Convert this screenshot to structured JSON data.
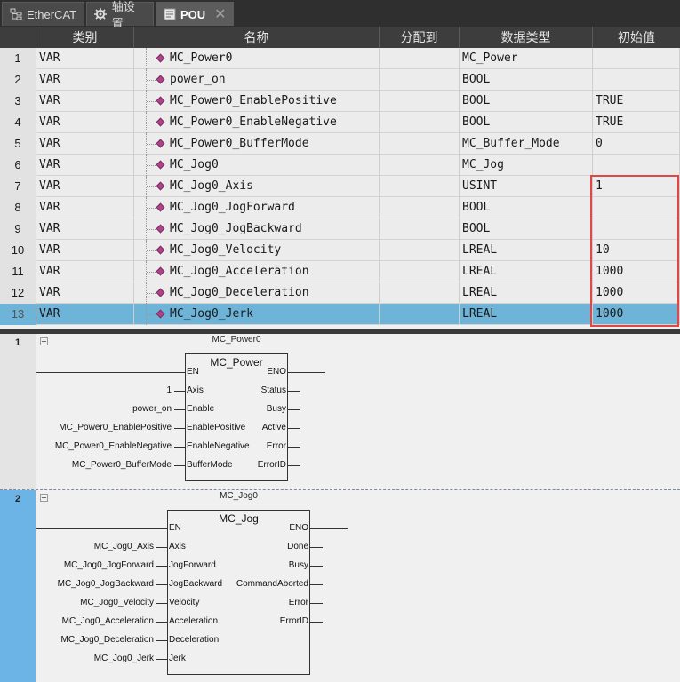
{
  "tabs": [
    {
      "label": "EtherCAT",
      "icon": "network-tree-icon"
    },
    {
      "label": "轴设置",
      "icon": "gear-icon"
    },
    {
      "label": "POU",
      "icon": "pou-icon"
    }
  ],
  "table": {
    "headers": [
      "类别",
      "名称",
      "分配到",
      "数据类型",
      "初始值"
    ],
    "rows": [
      {
        "num": "1",
        "cat": "VAR",
        "name": "MC_Power0",
        "alloc": "",
        "type": "MC_Power",
        "init": ""
      },
      {
        "num": "2",
        "cat": "VAR",
        "name": "power_on",
        "alloc": "",
        "type": "BOOL",
        "init": ""
      },
      {
        "num": "3",
        "cat": "VAR",
        "name": "MC_Power0_EnablePositive",
        "alloc": "",
        "type": "BOOL",
        "init": "TRUE"
      },
      {
        "num": "4",
        "cat": "VAR",
        "name": "MC_Power0_EnableNegative",
        "alloc": "",
        "type": "BOOL",
        "init": "TRUE"
      },
      {
        "num": "5",
        "cat": "VAR",
        "name": "MC_Power0_BufferMode",
        "alloc": "",
        "type": "MC_Buffer_Mode",
        "init": "0"
      },
      {
        "num": "6",
        "cat": "VAR",
        "name": "MC_Jog0",
        "alloc": "",
        "type": "MC_Jog",
        "init": ""
      },
      {
        "num": "7",
        "cat": "VAR",
        "name": "MC_Jog0_Axis",
        "alloc": "",
        "type": "USINT",
        "init": "1"
      },
      {
        "num": "8",
        "cat": "VAR",
        "name": "MC_Jog0_JogForward",
        "alloc": "",
        "type": "BOOL",
        "init": ""
      },
      {
        "num": "9",
        "cat": "VAR",
        "name": "MC_Jog0_JogBackward",
        "alloc": "",
        "type": "BOOL",
        "init": ""
      },
      {
        "num": "10",
        "cat": "VAR",
        "name": "MC_Jog0_Velocity",
        "alloc": "",
        "type": "LREAL",
        "init": "10"
      },
      {
        "num": "11",
        "cat": "VAR",
        "name": "MC_Jog0_Acceleration",
        "alloc": "",
        "type": "LREAL",
        "init": "1000"
      },
      {
        "num": "12",
        "cat": "VAR",
        "name": "MC_Jog0_Deceleration",
        "alloc": "",
        "type": "LREAL",
        "init": "1000"
      },
      {
        "num": "13",
        "cat": "VAR",
        "name": "MC_Jog0_Jerk",
        "alloc": "",
        "type": "LREAL",
        "init": "1000"
      }
    ]
  },
  "ladder": {
    "rungs": [
      {
        "num": "1",
        "instance": "MC_Power0",
        "fbtype": "MC_Power",
        "inputs": [
          {
            "pin": "EN",
            "arg": ""
          },
          {
            "pin": "Axis",
            "arg": "1"
          },
          {
            "pin": "Enable",
            "arg": "power_on"
          },
          {
            "pin": "EnablePositive",
            "arg": "MC_Power0_EnablePositive"
          },
          {
            "pin": "EnableNegative",
            "arg": "MC_Power0_EnableNegative"
          },
          {
            "pin": "BufferMode",
            "arg": "MC_Power0_BufferMode"
          }
        ],
        "outputs": [
          "ENO",
          "Status",
          "Busy",
          "Active",
          "Error",
          "ErrorID"
        ]
      },
      {
        "num": "2",
        "instance": "MC_Jog0",
        "fbtype": "MC_Jog",
        "inputs": [
          {
            "pin": "EN",
            "arg": ""
          },
          {
            "pin": "Axis",
            "arg": "MC_Jog0_Axis"
          },
          {
            "pin": "JogForward",
            "arg": "MC_Jog0_JogForward"
          },
          {
            "pin": "JogBackward",
            "arg": "MC_Jog0_JogBackward"
          },
          {
            "pin": "Velocity",
            "arg": "MC_Jog0_Velocity"
          },
          {
            "pin": "Acceleration",
            "arg": "MC_Jog0_Acceleration"
          },
          {
            "pin": "Deceleration",
            "arg": "MC_Jog0_Deceleration"
          },
          {
            "pin": "Jerk",
            "arg": "MC_Jog0_Jerk"
          }
        ],
        "outputs": [
          "ENO",
          "Done",
          "Busy",
          "CommandAborted",
          "Error",
          "ErrorID"
        ]
      }
    ]
  }
}
